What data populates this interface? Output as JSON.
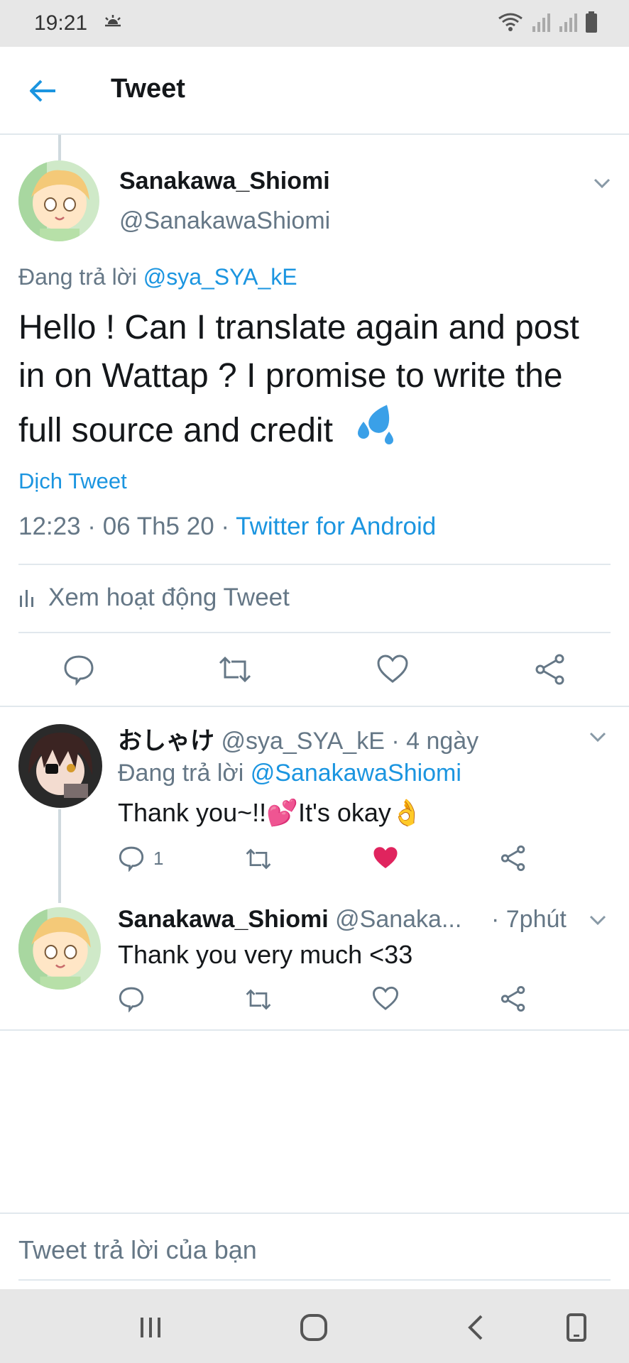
{
  "status": {
    "time": "19:21"
  },
  "header": {
    "title": "Tweet"
  },
  "main_tweet": {
    "display_name": "Sanakawa_Shiomi",
    "handle": "@SanakawaShiomi",
    "replying_prefix": "Đang trả lời",
    "replying_to": "@sya_SYA_kE",
    "text": "Hello ! Can I translate again and post in on Wattap ? I promise to write the full source and credit",
    "emoji": "💦",
    "translate_label": "Dịch Tweet",
    "timestamp": "12:23 · 06 Th5 20 ·",
    "source": "Twitter for Android",
    "activity_label": "Xem hoạt động Tweet"
  },
  "replies": [
    {
      "display_name": "おしゃけ",
      "handle_time": "@sya_SYA_kE · 4 ngày",
      "replying_prefix": "Đang trả lời",
      "replying_to": "@SanakawaShiomi",
      "text_a": "Thank you~!!",
      "emoji_a": "💕",
      "text_b": "It's okay",
      "emoji_b": "👌",
      "reply_count": "1",
      "liked": true
    },
    {
      "display_name": "Sanakawa_Shiomi",
      "handle": "@Sanaka...",
      "time": "· 7phút",
      "text": "Thank you very much <33",
      "liked": false
    }
  ],
  "composer": {
    "placeholder": "Tweet trả lời của bạn"
  },
  "colors": {
    "accent": "#1b95e0",
    "muted": "#657786",
    "like": "#e0245e",
    "divider": "#e1e8ed"
  }
}
